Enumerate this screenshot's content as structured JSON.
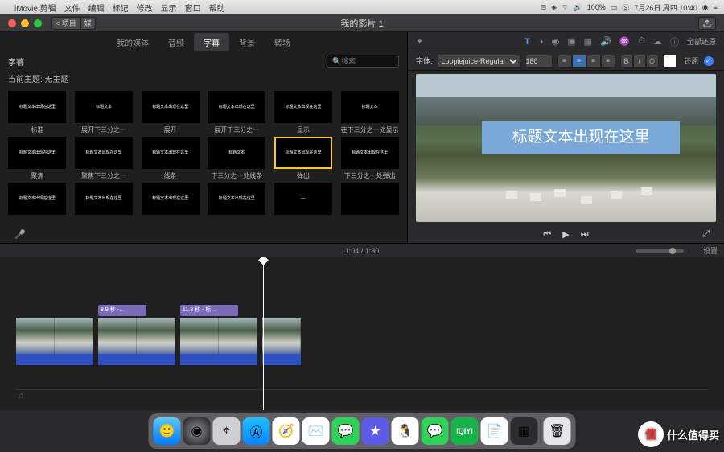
{
  "menubar": {
    "apple": "",
    "items": [
      "iMovie 剪辑",
      "文件",
      "编辑",
      "标记",
      "修改",
      "显示",
      "窗口",
      "帮助"
    ],
    "battery": "100%",
    "date": "7月26日 周四 10:40"
  },
  "titlebar": {
    "project_btn": "< 项目",
    "media_btn": "媒",
    "title": "我的影片 1"
  },
  "tabs": [
    "我的媒体",
    "音频",
    "字幕",
    "背景",
    "转场"
  ],
  "active_tab_index": 2,
  "panel": {
    "heading": "字幕",
    "search_placeholder": "搜索",
    "theme_label": "当前主题: 无主题"
  },
  "tiles": [
    {
      "preview": "标题文本出现在这里",
      "label": "标准"
    },
    {
      "preview": "标题文本",
      "label": "展开下三分之一"
    },
    {
      "preview": "标题文本出现在这里",
      "label": "展开"
    },
    {
      "preview": "标题文本出现在这里",
      "label": "展开下三分之一"
    },
    {
      "preview": "标题文本出现在这里",
      "label": "显示"
    },
    {
      "preview": "标题文本",
      "label": "在下三分之一处显示"
    },
    {
      "preview": "标题文本出现在这里",
      "label": "聚焦"
    },
    {
      "preview": "标题文本出现在这里",
      "label": "聚焦下三分之一"
    },
    {
      "preview": "标题文本出现在这里",
      "label": "线条"
    },
    {
      "preview": "标题文本",
      "label": "下三分之一处线条"
    },
    {
      "preview": "标题文本出现在这里",
      "label": "弹出",
      "selected": true
    },
    {
      "preview": "标题文本出现在这里",
      "label": "下三分之一处弹出"
    },
    {
      "preview": "标题文本出现在这里",
      "label": ""
    },
    {
      "preview": "标题文本出现在这里",
      "label": ""
    },
    {
      "preview": "标题文本出现在这里",
      "label": ""
    },
    {
      "preview": "标题文本出现在这里",
      "label": ""
    },
    {
      "preview": "—",
      "label": ""
    },
    {
      "preview": "",
      "label": ""
    }
  ],
  "inspector": {
    "reset_all": "全部还原",
    "font_label": "字体:",
    "font_value": "Loopiejuice-Regular",
    "size_value": "180",
    "reset": "还原"
  },
  "preview_title": "标题文本出现在这里",
  "timeline": {
    "time": "1:04 / 1:30",
    "settings": "设置",
    "title_clip1": "8.9 秒 -…",
    "title_clip2": "11.3 秒 - 标…"
  },
  "watermark": "什么值得买"
}
